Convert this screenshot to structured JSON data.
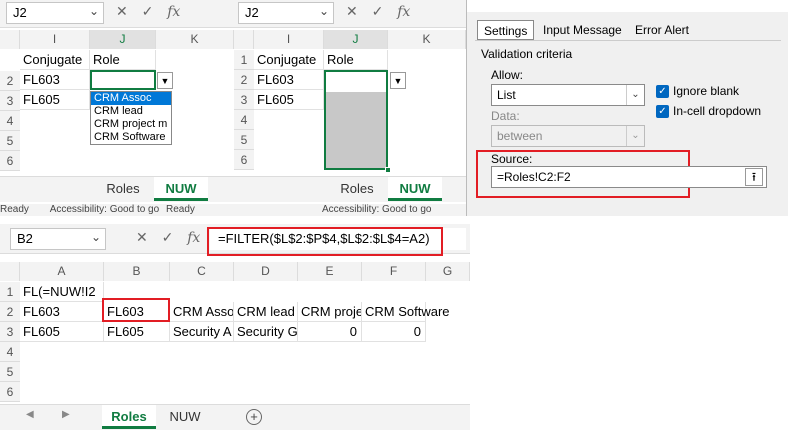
{
  "left_sheet": {
    "namebox": "J2",
    "cols": [
      "I",
      "J",
      "K"
    ],
    "rows": [
      "2",
      "3",
      "4",
      "5",
      "6"
    ],
    "header_row": [
      "Conjugate",
      "Role"
    ],
    "cells": [
      [
        "FL603",
        ""
      ],
      [
        "FL605",
        ""
      ]
    ],
    "dropdown": [
      "CRM Assoc",
      "CRM lead",
      "CRM project m",
      "CRM Software"
    ],
    "tabs": [
      "Roles",
      "NUW"
    ],
    "status": [
      "Ready",
      "Accessibility: Good to go",
      "Ready"
    ]
  },
  "mid_sheet": {
    "namebox": "J2",
    "cols": [
      "I",
      "J",
      "K"
    ],
    "rows": [
      "1",
      "2",
      "3",
      "4",
      "5",
      "6"
    ],
    "header_row": [
      "Conjugate",
      "Role"
    ],
    "cells": [
      [
        "FL603",
        ""
      ],
      [
        "FL605",
        ""
      ]
    ],
    "tabs": [
      "Roles",
      "NUW"
    ],
    "status": "Accessibility: Good to go"
  },
  "dialog": {
    "tabs": [
      "Settings",
      "Input Message",
      "Error Alert"
    ],
    "section": "Validation criteria",
    "allow_label": "Allow:",
    "allow_value": "List",
    "data_label": "Data:",
    "data_value": "between",
    "ignore_blank": "Ignore blank",
    "in_cell_dropdown": "In-cell dropdown",
    "source_label": "Source:",
    "source_value": "=Roles!C2:F2"
  },
  "bottom_sheet": {
    "namebox": "B2",
    "formula": "=FILTER($L$2:$P$4,$L$2:$L$4=A2)",
    "cols": [
      "A",
      "B",
      "C",
      "D",
      "E",
      "F",
      "G"
    ],
    "rows": [
      "1",
      "2",
      "3",
      "4",
      "5",
      "6"
    ],
    "row1": [
      "FL(=NUW!I2"
    ],
    "row2": [
      "FL603",
      "FL603",
      "CRM Asso",
      "CRM lead",
      "CRM proje",
      "CRM Software"
    ],
    "row3": [
      "FL605",
      "FL605",
      "Security A",
      "Security G",
      "0",
      "0"
    ],
    "tabs": [
      "Roles",
      "NUW"
    ]
  },
  "icons": {
    "fx": "fx",
    "cancel": "✕",
    "enter": "✓"
  },
  "colors": {
    "accent": "#107c41",
    "highlight": "#e21d24",
    "selection": "#0078d7"
  }
}
